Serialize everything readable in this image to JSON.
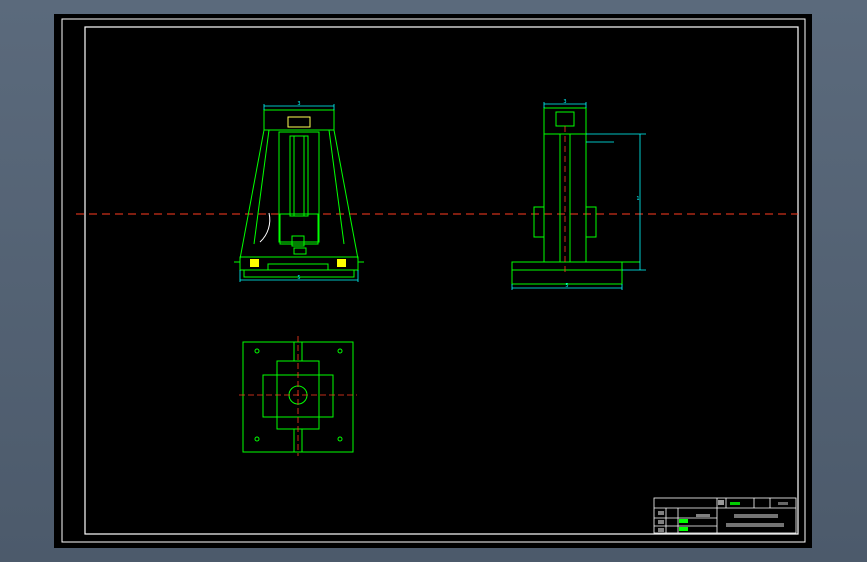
{
  "app": {
    "accent_colors": {
      "background_outer": "#55637a",
      "canvas": "#000000",
      "border": "#ffffff",
      "outline": "#00ff00",
      "dimension": "#00ffff",
      "centerline": "#ff3b1f",
      "highlight": "#ffff00"
    }
  },
  "drawing": {
    "front_view": {
      "top_dim": "3",
      "bottom_dim": "5"
    },
    "side_view": {
      "top_dim": "3",
      "height_dim": "1",
      "bottom_dim": "5"
    },
    "title_block": {
      "top_row": [
        "",
        "",
        "",
        ""
      ],
      "title_line1": "",
      "title_line2": "",
      "labels": [
        "",
        "",
        ""
      ]
    }
  }
}
